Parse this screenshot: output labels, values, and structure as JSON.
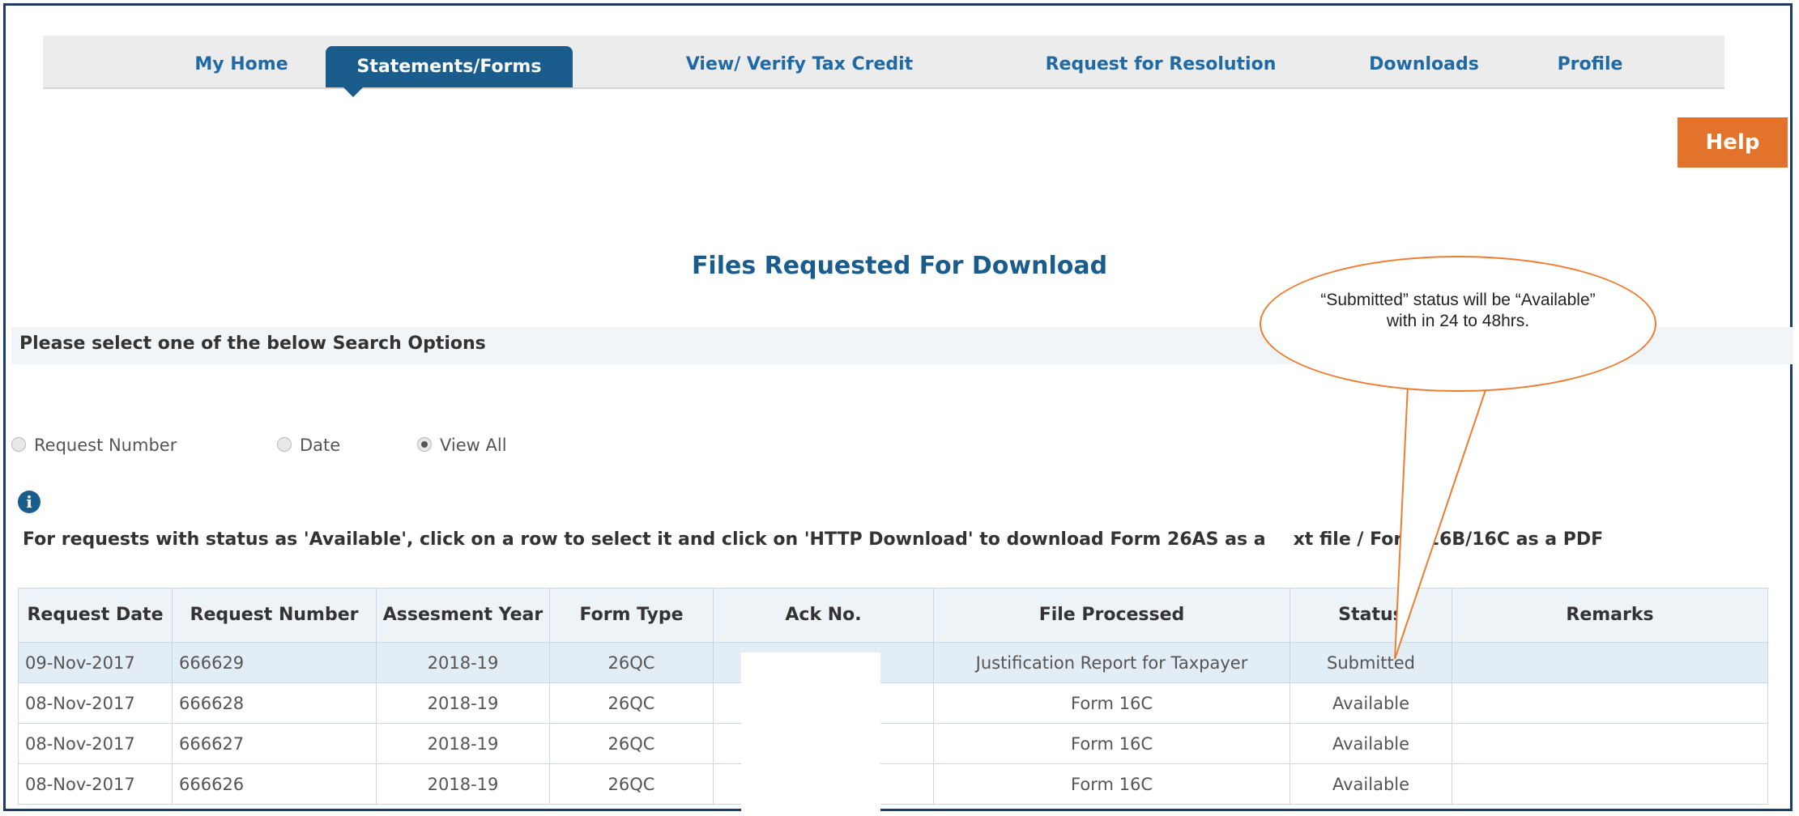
{
  "nav": {
    "tabs": [
      {
        "label": "My Home",
        "active": false
      },
      {
        "label": "Statements/Forms",
        "active": true
      },
      {
        "label": "View/ Verify Tax Credit",
        "active": false
      },
      {
        "label": "Request for Resolution",
        "active": false
      },
      {
        "label": "Downloads",
        "active": false
      },
      {
        "label": "Profile",
        "active": false
      }
    ],
    "help_label": "Help"
  },
  "page": {
    "title": "Files Requested For Download",
    "search_heading": "Please select one of the below Search Options",
    "search_options": [
      {
        "label": "Request Number",
        "selected": false
      },
      {
        "label": "Date",
        "selected": false
      },
      {
        "label": "View All",
        "selected": true
      }
    ],
    "info_text": "For requests with status as 'Available', click on a row to select it and click on 'HTTP Download' to download Form 26AS as a",
    "info_text_tail": "xt file / Form 16B/16C as a PDF"
  },
  "table": {
    "headers": [
      "Request Date",
      "Request Number",
      "Assesment Year",
      "Form Type",
      "Ack No.",
      "File Processed",
      "Status",
      "Remarks"
    ],
    "rows": [
      [
        "09-Nov-2017",
        "666629",
        "2018-19",
        "26QC",
        "",
        "Justification Report for Taxpayer",
        "Submitted",
        ""
      ],
      [
        "08-Nov-2017",
        "666628",
        "2018-19",
        "26QC",
        "",
        "Form 16C",
        "Available",
        ""
      ],
      [
        "08-Nov-2017",
        "666627",
        "2018-19",
        "26QC",
        "",
        "Form 16C",
        "Available",
        ""
      ],
      [
        "08-Nov-2017",
        "666626",
        "2018-19",
        "26QC",
        "",
        "Form 16C",
        "Available",
        ""
      ]
    ]
  },
  "callout": {
    "text": "“Submitted” status will be “Available” with in 24 to 48hrs."
  },
  "colors": {
    "accent": "#1a5d8c",
    "help": "#e3732a",
    "callout_border": "#ec7d31"
  }
}
